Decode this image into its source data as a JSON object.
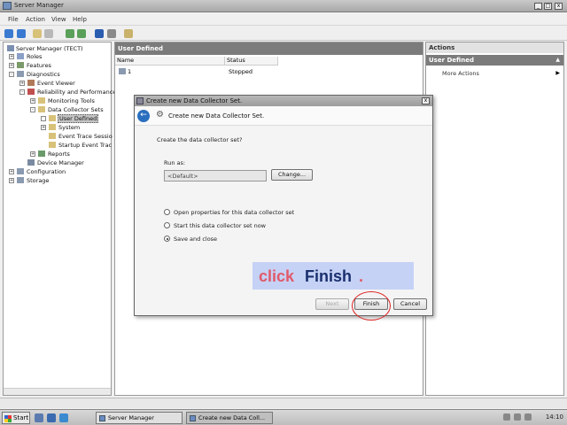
{
  "window": {
    "title": "Server Manager"
  },
  "menu": [
    "File",
    "Action",
    "View",
    "Help"
  ],
  "tree": {
    "root": "Server Manager (TECT)",
    "roles": "Roles",
    "features": "Features",
    "diagnostics": "Diagnostics",
    "event_viewer": "Event Viewer",
    "reliability": "Reliability and Performance",
    "monitoring_tools": "Monitoring Tools",
    "data_collector_sets": "Data Collector Sets",
    "user_defined": "User Defined",
    "system": "System",
    "event_trace_sessions": "Event Trace Sessio",
    "startup_event_trace": "Startup Event Trac",
    "reports": "Reports",
    "device_manager": "Device Manager",
    "configuration": "Configuration",
    "storage": "Storage"
  },
  "center": {
    "header": "User Defined",
    "columns": [
      "Name",
      "Status"
    ],
    "rows": [
      {
        "name": "1",
        "status": "Stopped"
      }
    ]
  },
  "actions": {
    "header": "Actions",
    "section": "User Defined",
    "more_actions": "More Actions"
  },
  "dialog": {
    "title": "Create new Data Collector Set.",
    "header_title": "Create new Data Collector Set.",
    "prompt": "Create the data collector set?",
    "run_as_label": "Run as:",
    "run_as_value": "<Default>",
    "change_button": "Change...",
    "options": [
      {
        "label": "Open properties for this data collector set",
        "selected": false
      },
      {
        "label": "Start this data collector set now",
        "selected": false
      },
      {
        "label": "Save and close",
        "selected": true
      }
    ],
    "next_button": "Next",
    "finish_button": "Finish",
    "cancel_button": "Cancel"
  },
  "callout": {
    "part1": "click",
    "part2": "Finish",
    "part3": "."
  },
  "taskbar": {
    "start": "Start",
    "tasks": [
      "Server Manager",
      "Create new Data Coll..."
    ],
    "clock": "14:10"
  },
  "colors": {
    "callout_bg": "#c6d2f5",
    "callout_accent": "#e05a6a",
    "callout_main": "#1a2f6e",
    "highlight": "#dd2222"
  }
}
